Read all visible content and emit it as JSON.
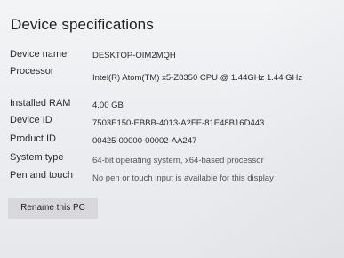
{
  "section": {
    "title": "Device specifications"
  },
  "specs": [
    {
      "label": "Device name",
      "value": "DESKTOP-OIM2MQH"
    },
    {
      "label": "Processor",
      "value": "Intel(R) Atom(TM) x5-Z8350  CPU @ 1.44GHz   1.44 GHz"
    },
    {
      "label": "Installed RAM",
      "value": "4.00 GB"
    },
    {
      "label": "Device ID",
      "value": "7503E150-EBBB-4013-A2FE-81E48B16D443"
    },
    {
      "label": "Product ID",
      "value": "00425-00000-00002-AA247"
    },
    {
      "label": "System type",
      "value": "64-bit operating system, x64-based processor"
    },
    {
      "label": "Pen and touch",
      "value": "No pen or touch input is available for this display"
    }
  ],
  "actions": {
    "rename_label": "Rename this PC"
  }
}
